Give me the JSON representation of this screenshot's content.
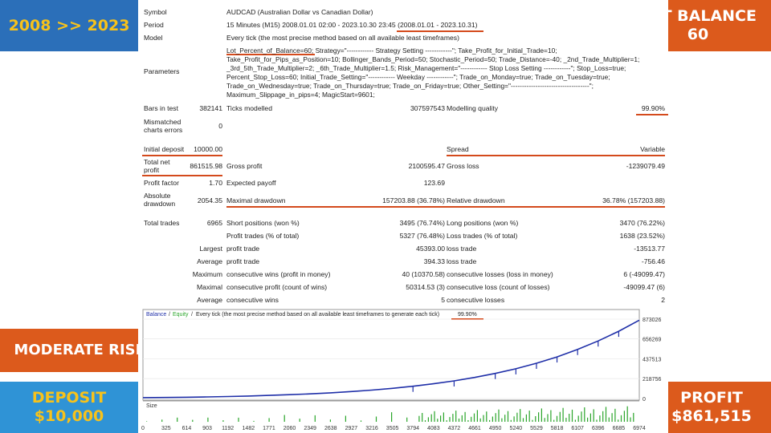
{
  "badges": {
    "years": "2008 >> 2023",
    "lot_line1": "LOT BALANCE",
    "lot_line2": "60",
    "risk": "MODERATE RISK",
    "deposit_line1": "DEPOSIT",
    "deposit_line2": "$10,000",
    "profit_line1": "PROFIT",
    "profit_line2": "$861,515"
  },
  "report": {
    "symbol_label": "Symbol",
    "symbol_value": "AUDCAD (Australian Dollar vs Canadian Dollar)",
    "period_label": "Period",
    "period_value": "15 Minutes (M15) 2008.01.01 02:00 - 2023.10.30 23:45",
    "period_range": "(2008.01.01 - 2023.10.31)",
    "model_label": "Model",
    "model_value": "Every tick (the most precise method based on all available least timeframes)",
    "parameters_label": "Parameters",
    "parameters_lot": "Lot_Percent_of_Balance=60;",
    "parameters_rest": " Strategy=\"------------ Strategy Setting ------------\"; Take_Profit_for_Initial_Trade=10; Take_Profit_for_Pips_as_Position=10; Bollinger_Bands_Period=50; Stochastic_Period=50; Trade_Distance=-40; _2nd_Trade_Multiplier=1; _3rd_5th_Trade_Multiplier=2; _6th_Trade_Multiplier=1.5; Risk_Management=\"------------ Stop Loss Setting ------------\"; Stop_Loss=true; Percent_Stop_Loss=60; Initial_Trade_Setting=\"------------ Weekday ------------\"; Trade_on_Monday=true; Trade_on_Tuesday=true; Trade_on_Wednesday=true; Trade_on_Thursday=true; Trade_on_Friday=true; Other_Setting=\"-----------------------------------\"; Maximum_Slippage_in_pips=4; MagicStart=9601;",
    "bars_label": "Bars in test",
    "bars_value": "382141",
    "ticks_label": "Ticks modelled",
    "ticks_value": "307597543",
    "quality_label": "Modelling quality",
    "quality_value": "99.90%",
    "mismatched_label_1": "Mismatched",
    "mismatched_label_2": "charts errors",
    "mismatched_value": "0",
    "initial_deposit_label": "Initial deposit",
    "initial_deposit_value": "10000.00",
    "spread_label": "Spread",
    "spread_value": "Variable",
    "net_profit_label_1": "Total net",
    "net_profit_label_2": "profit",
    "net_profit_value": "861515.98",
    "gross_profit_label": "Gross profit",
    "gross_profit_value": "2100595.47",
    "gross_loss_label": "Gross loss",
    "gross_loss_value": "-1239079.49",
    "profit_factor_label": "Profit factor",
    "profit_factor_value": "1.70",
    "expected_payoff_label": "Expected payoff",
    "expected_payoff_value": "123.69",
    "absolute_dd_label_1": "Absolute",
    "absolute_dd_label_2": "drawdown",
    "absolute_dd_value": "2054.35",
    "max_dd_label": "Maximal drawdown",
    "max_dd_value": "157203.88 (36.78%)",
    "rel_dd_label": "Relative drawdown",
    "rel_dd_value": "36.78% (157203.88)",
    "total_trades_label": "Total trades",
    "total_trades_value": "6965",
    "short_label": "Short positions (won %)",
    "short_value": "3495 (76.74%)",
    "long_label": "Long positions (won %)",
    "long_value": "3470 (76.22%)",
    "profit_trades_label": "Profit trades (% of total)",
    "profit_trades_value": "5327 (76.48%)",
    "loss_trades_label": "Loss trades (% of total)",
    "loss_trades_value": "1638 (23.52%)",
    "largest_label": "Largest",
    "largest_profit_label": "profit trade",
    "largest_profit_value": "45393.00",
    "largest_loss_label": "loss trade",
    "largest_loss_value": "-13513.77",
    "average_label": "Average",
    "average_profit_label": "profit trade",
    "average_profit_value": "394.33",
    "average_loss_label": "loss trade",
    "average_loss_value": "-756.46",
    "maximum_label": "Maximum",
    "max_cons_wins_label": "consecutive wins (profit in money)",
    "max_cons_wins_value": "40 (10370.58)",
    "max_cons_losses_label": "consecutive losses (loss in money)",
    "max_cons_losses_value": "6 (-49099.47)",
    "maximal_label": "Maximal",
    "maximal_profit_label": "consecutive profit (count of wins)",
    "maximal_profit_value": "50314.53 (3)",
    "maximal_loss_label": "consecutive loss (count of losses)",
    "maximal_loss_value": "-49099.47 (6)",
    "average2_label": "Average",
    "avg_cons_wins_label": "consecutive wins",
    "avg_cons_wins_value": "5",
    "avg_cons_losses_label": "consecutive losses",
    "avg_cons_losses_value": "2"
  },
  "chart_data": {
    "type": "line",
    "legend": [
      "Balance",
      "Equity"
    ],
    "legend_separator": "/",
    "subtitle": "Every tick (the most precise method based on all available least timeframes to generate each tick)",
    "quality": "99.90%",
    "size_label": "Size",
    "x_ticks": [
      "0",
      "325",
      "614",
      "903",
      "1192",
      "1482",
      "1771",
      "2060",
      "2349",
      "2638",
      "2927",
      "3216",
      "3505",
      "3794",
      "4083",
      "4372",
      "4661",
      "4950",
      "5240",
      "5529",
      "5818",
      "6107",
      "6396",
      "6685",
      "6974"
    ],
    "y_ticks": [
      "873026",
      "656269",
      "437513",
      "218756",
      "0"
    ],
    "ylim": [
      0,
      873026
    ],
    "xlim": [
      0,
      6974
    ],
    "balance": {
      "x": [
        0,
        325,
        614,
        903,
        1192,
        1482,
        1771,
        2060,
        2349,
        2638,
        2927,
        3216,
        3505,
        3794,
        4083,
        4372,
        4661,
        4950,
        5240,
        5529,
        5818,
        6107,
        6396,
        6685,
        6974
      ],
      "y": [
        10000,
        11500,
        14000,
        17500,
        22000,
        27500,
        34000,
        42000,
        51500,
        63000,
        77000,
        93000,
        112000,
        135000,
        162000,
        194000,
        232000,
        276000,
        327000,
        388000,
        458000,
        540000,
        633000,
        740000,
        861516
      ]
    },
    "colors": {
      "balance": "#1f2fa8",
      "equity": "#2aa52a",
      "accent": "#d44a1c"
    }
  },
  "accent": "#d44a1c"
}
